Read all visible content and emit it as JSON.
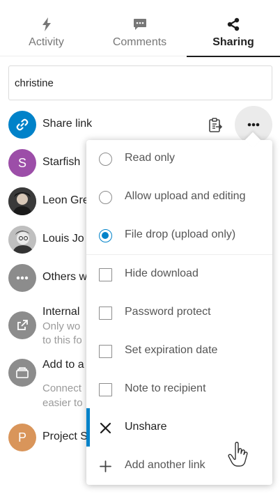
{
  "tabs": [
    {
      "label": "Activity",
      "icon": "activity-icon",
      "active": false
    },
    {
      "label": "Comments",
      "icon": "comments-icon",
      "active": false
    },
    {
      "label": "Sharing",
      "icon": "share-icon",
      "active": true
    }
  ],
  "search": {
    "value": "christine"
  },
  "shares": {
    "share_link": {
      "label": "Share link",
      "icon": "link-icon",
      "color": "#0082c9"
    },
    "starfish": {
      "label": "Starfish",
      "initial": "S",
      "color": "#9c4ea8"
    },
    "leon": {
      "label": "Leon Gre"
    },
    "louis": {
      "label": "Louis Jo"
    },
    "others": {
      "label": "Others w"
    },
    "internal": {
      "label": "Internal",
      "sub1": "Only wo",
      "sub2": "to this fo"
    },
    "add_to": {
      "label": "Add to a",
      "sub1": "Connect",
      "sub2": "easier to"
    },
    "project": {
      "label": "Project S",
      "initial": "P",
      "color": "#d9955a"
    }
  },
  "menu": {
    "read_only": "Read only",
    "allow_upload": "Allow upload and editing",
    "file_drop": "File drop (upload only)",
    "hide_download": "Hide download",
    "password_protect": "Password protect",
    "set_expiration": "Set expiration date",
    "note_to_recipient": "Note to recipient",
    "unshare": "Unshare",
    "add_another_link": "Add another link",
    "selected_permission": "file_drop"
  },
  "colors": {
    "accent": "#0082c9",
    "muted": "#8c8c8c"
  }
}
